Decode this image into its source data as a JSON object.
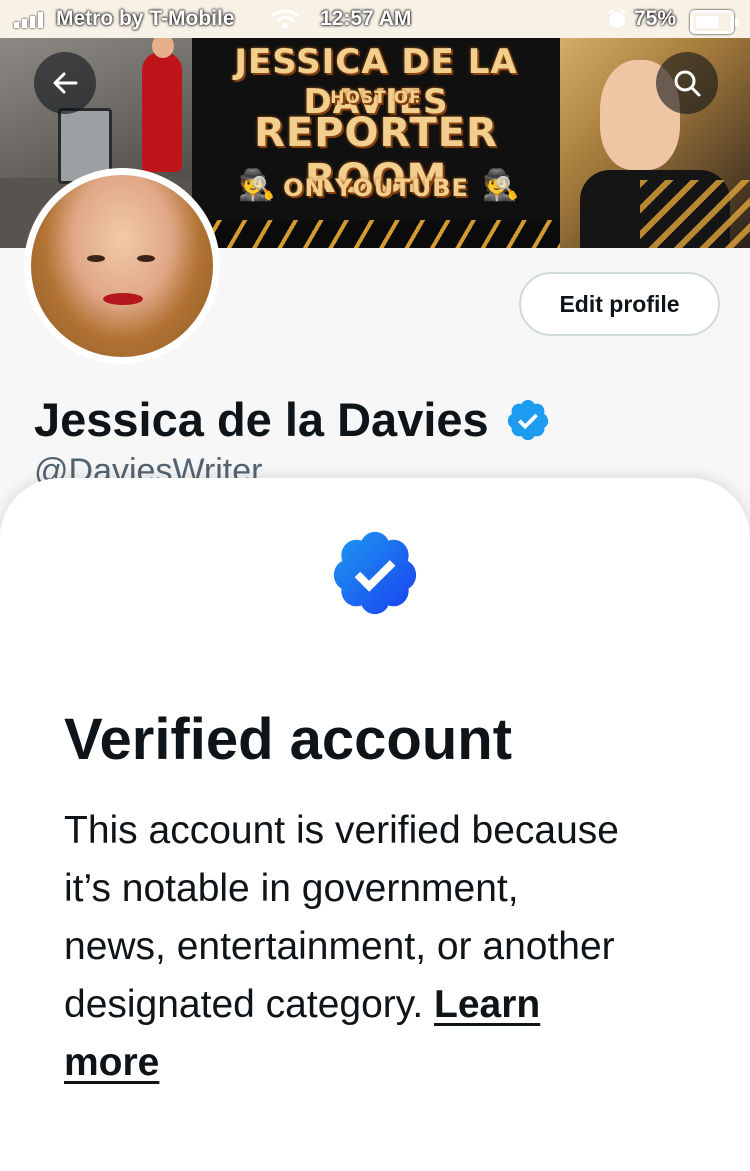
{
  "status_bar": {
    "carrier": "Metro by T-Mobile",
    "time": "12:57 AM",
    "battery": "75%",
    "icons": [
      "signal-icon",
      "wifi-icon",
      "alarm-icon",
      "battery-icon"
    ]
  },
  "banner": {
    "title": "JESSICA DE LA DAVIES",
    "host_of": "HOST OF",
    "show": "REPORTER ROOM",
    "platform": "ON YOUTUBE",
    "spy_glyph": "🕵"
  },
  "nav": {
    "back_icon": "back-arrow-icon",
    "search_icon": "search-icon"
  },
  "profile": {
    "display_name": "Jessica de la Davies",
    "handle": "@DaviesWriter",
    "edit_profile_label": "Edit profile"
  },
  "sheet": {
    "title": "Verified account",
    "body": "This account is verified because it’s notable in government, news, entertainment, or another designated category.",
    "link_label": "Learn more"
  },
  "colors": {
    "verified_blue": "#1d9bf0",
    "text_primary": "#0f1419",
    "text_secondary": "#536471",
    "border": "#cfd9de"
  }
}
